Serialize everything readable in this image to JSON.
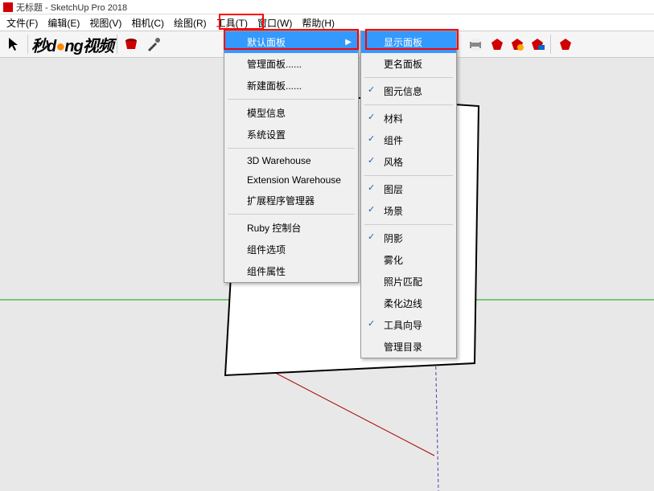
{
  "titlebar": {
    "title": "无标题 - SketchUp Pro 2018"
  },
  "menubar": {
    "items": [
      {
        "label": "文件(F)"
      },
      {
        "label": "编辑(E)"
      },
      {
        "label": "视图(V)"
      },
      {
        "label": "相机(C)"
      },
      {
        "label": "绘图(R)"
      },
      {
        "label": "工具(T)"
      },
      {
        "label": "窗口(W)"
      },
      {
        "label": "帮助(H)"
      }
    ]
  },
  "logo": {
    "text": "秒d ng视频"
  },
  "window_menu": {
    "items": [
      {
        "label": "默认面板",
        "has_arrow": true,
        "highlighted": true
      },
      {
        "label": "管理面板......"
      },
      {
        "label": "新建面板......"
      },
      {
        "sep": true
      },
      {
        "label": "模型信息"
      },
      {
        "label": "系统设置"
      },
      {
        "sep": true
      },
      {
        "label": "3D Warehouse"
      },
      {
        "label": "Extension Warehouse"
      },
      {
        "label": "扩展程序管理器"
      },
      {
        "sep": true
      },
      {
        "label": "Ruby 控制台"
      },
      {
        "label": "组件选项"
      },
      {
        "label": "组件属性"
      }
    ]
  },
  "panel_submenu": {
    "items": [
      {
        "label": "显示面板",
        "highlighted": true
      },
      {
        "label": "更名面板"
      },
      {
        "sep": true
      },
      {
        "label": "图元信息",
        "checked": true
      },
      {
        "sep": true
      },
      {
        "label": "材料",
        "checked": true
      },
      {
        "label": "组件",
        "checked": true
      },
      {
        "label": "风格",
        "checked": true
      },
      {
        "sep": true
      },
      {
        "label": "图层",
        "checked": true
      },
      {
        "label": "场景",
        "checked": true
      },
      {
        "sep": true
      },
      {
        "label": "阴影",
        "checked": true
      },
      {
        "label": "雾化"
      },
      {
        "label": "照片匹配"
      },
      {
        "label": "柔化边线"
      },
      {
        "label": "工具向导",
        "checked": true
      },
      {
        "label": "管理目录"
      }
    ]
  },
  "toolbar_icons": [
    "cursor",
    "bucket",
    "camera",
    "undo",
    "redo",
    "print",
    "printer2",
    "ruby1",
    "ruby2",
    "ruby3",
    "ruby4"
  ]
}
